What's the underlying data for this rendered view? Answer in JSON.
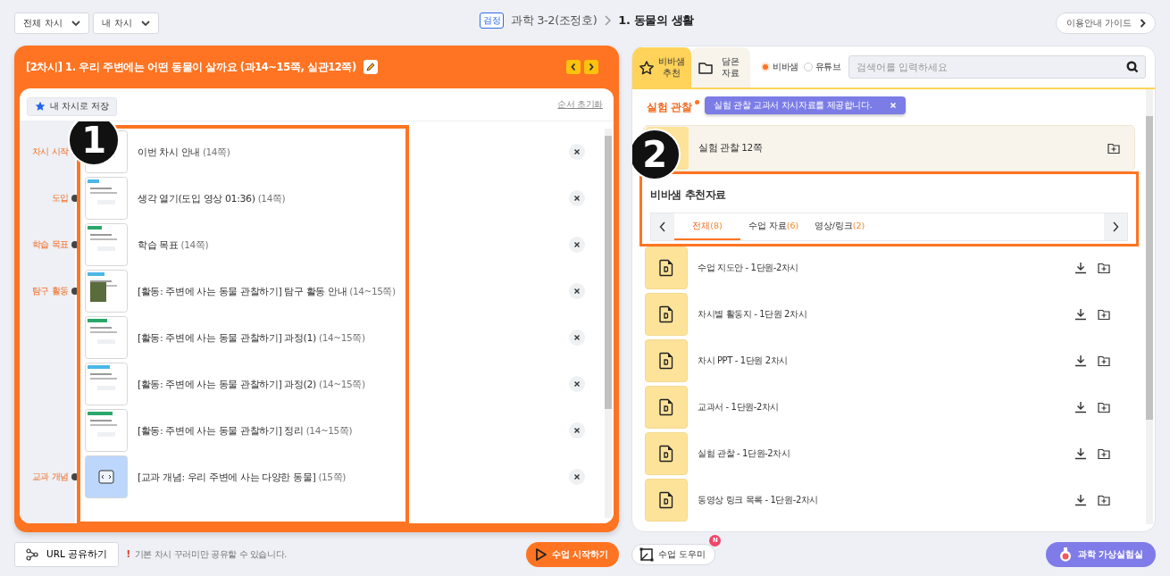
{
  "top_bar": {
    "dropdowns": [
      "전체 차시",
      "내 차시"
    ],
    "badge": "검정",
    "book": "과학 3-2(조정호)",
    "unit": "1. 동물의 생활",
    "guide_button": "이용안내 가이드"
  },
  "lesson_panel": {
    "title": "[2차시] 1. 우리 주변에는 어떤 동물이 살까요 (과14~15쪽, 실관12쪽)",
    "save_button": "내 차시로 저장",
    "reset_link": "순서 초기화",
    "callout": "1",
    "items": [
      {
        "stage": "차시 시작",
        "title": "이번 차시 안내",
        "pages": "(14쪽)",
        "kind": "slide"
      },
      {
        "stage": "도입",
        "title": "생각 열기(도입 영상 01:36)",
        "pages": "(14쪽)",
        "kind": "slide"
      },
      {
        "stage": "학습 목표",
        "title": "학습 목표",
        "pages": "(14쪽)",
        "kind": "slide"
      },
      {
        "stage": "탐구 활동",
        "title": "[활동: 주변에 사는 동물 관찰하기] 탐구 활동 안내",
        "pages": "(14~15쪽)",
        "kind": "slide"
      },
      {
        "title": "[활동: 주변에 사는 동물 관찰하기] 과정(1)",
        "pages": "(14~15쪽)",
        "kind": "slide"
      },
      {
        "title": "[활동: 주변에 사는 동물 관찰하기] 과정(2)",
        "pages": "(14~15쪽)",
        "kind": "slide"
      },
      {
        "title": "[활동: 주변에 사는 동물 관찰하기] 정리",
        "pages": "(14~15쪽)",
        "kind": "slide"
      },
      {
        "stage": "교과 개념",
        "title": "[교과 개념: 우리 주변에 사는 다양한 동물]",
        "pages": "(15쪽)",
        "kind": "code"
      }
    ]
  },
  "resource_panel": {
    "tabs": [
      {
        "label": "비바샘 추천",
        "selected": true,
        "kind": "recommend"
      },
      {
        "label": "담은 자료",
        "selected": false,
        "kind": "saved"
      }
    ],
    "sources": [
      {
        "label": "비바샘",
        "selected": true
      },
      {
        "label": "유튜브",
        "selected": false
      }
    ],
    "search": {
      "placeholder": "검색어를 입력하세요"
    },
    "section": "실험 관찰",
    "tooltip": "실험 관찰 교과서 차시자료를 제공합니다.",
    "card": "실험 관찰 12쪽",
    "callout": "2",
    "recommend_title": "비바샘 추천자료",
    "filters": [
      {
        "label": "전체",
        "count": "(8)",
        "selected": true
      },
      {
        "label": "수업 자료",
        "count": "(6)",
        "selected": false
      },
      {
        "label": "영상/링크",
        "count": "(2)",
        "selected": false
      }
    ],
    "files": [
      "수업 지도안 - 1단원-2차시",
      "차시별 활동지 - 1단원 2차시",
      "차시 PPT - 1단원 2차시",
      "교과서 - 1단원-2차시",
      "실험 관찰 - 1단원-2차시",
      "동영상 링크 목록 - 1단원-2차시"
    ]
  },
  "bottom_bar": {
    "share_button": "URL 공유하기",
    "notice_mark": "!",
    "notice": "기본 차시 꾸러미만 공유할 수 있습니다.",
    "start_button": "수업 시작하기",
    "helper_button": "수업 도우미",
    "helper_badge": "N",
    "lab_button": "과학 가상실험실"
  }
}
